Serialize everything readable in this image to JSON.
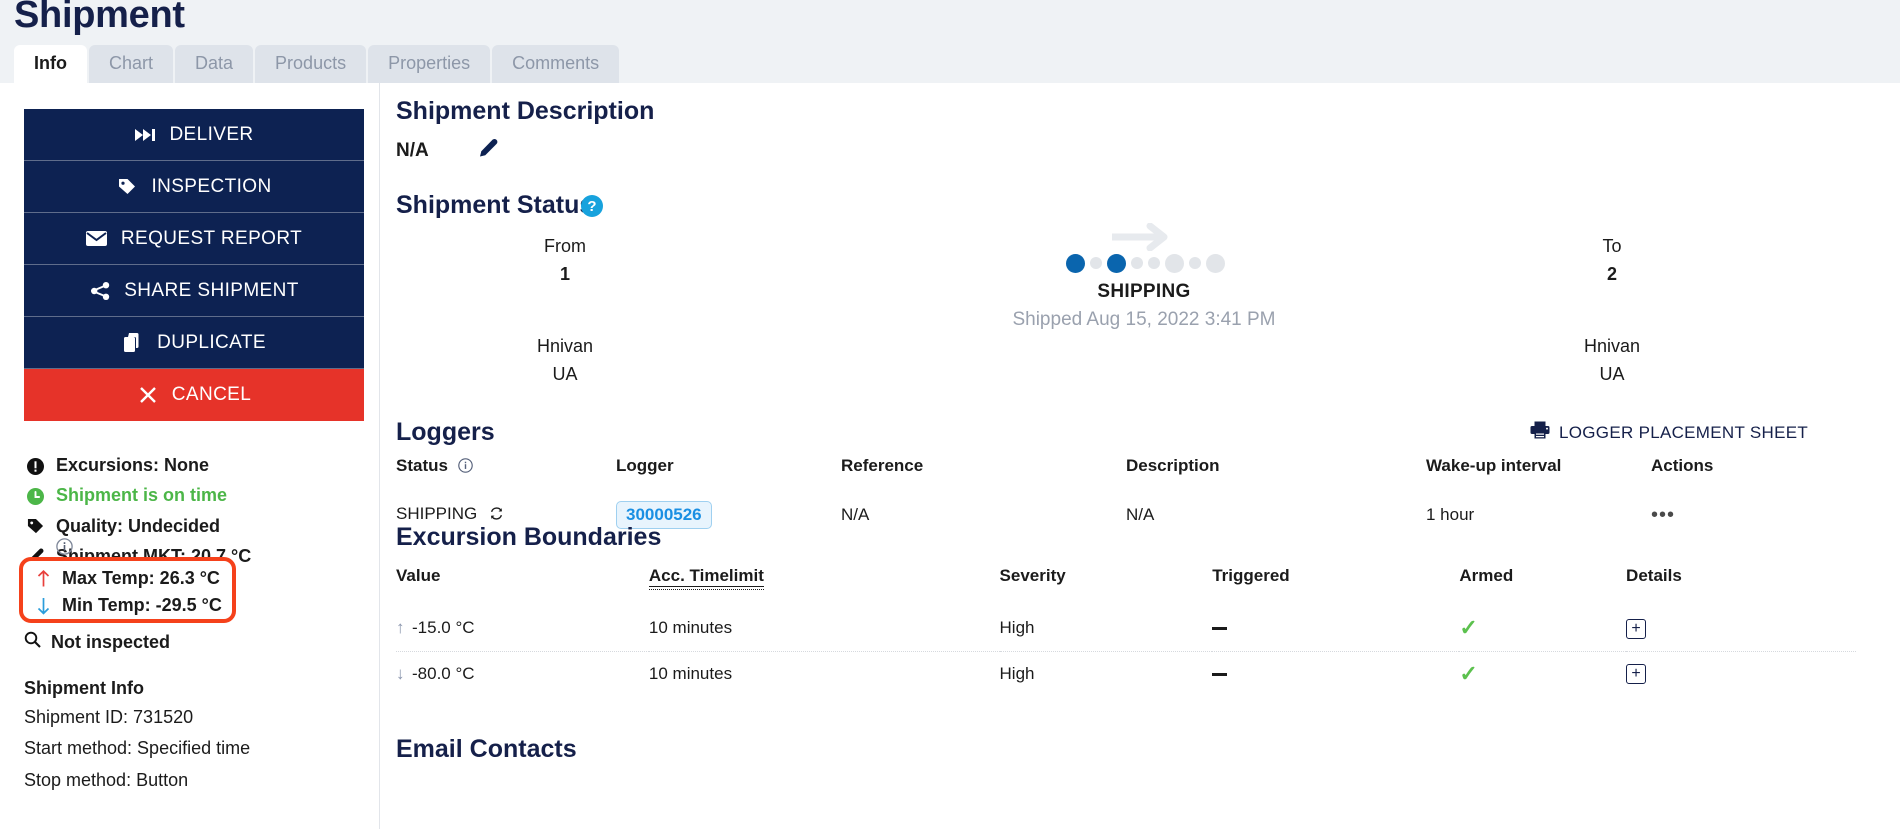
{
  "header": {
    "title": "Shipment",
    "tabs": [
      {
        "label": "Info",
        "active": true
      },
      {
        "label": "Chart",
        "active": false
      },
      {
        "label": "Data",
        "active": false
      },
      {
        "label": "Products",
        "active": false
      },
      {
        "label": "Properties",
        "active": false
      },
      {
        "label": "Comments",
        "active": false
      }
    ]
  },
  "sidebar": {
    "actions": [
      {
        "label": "DELIVER",
        "icon": "fast-forward-icon",
        "style": "dark"
      },
      {
        "label": "INSPECTION",
        "icon": "tag-icon",
        "style": "dark"
      },
      {
        "label": "REQUEST REPORT",
        "icon": "envelope-icon",
        "style": "dark"
      },
      {
        "label": "SHARE SHIPMENT",
        "icon": "share-icon",
        "style": "dark"
      },
      {
        "label": "DUPLICATE",
        "icon": "copy-icon",
        "style": "dark"
      },
      {
        "label": "CANCEL",
        "icon": "close-icon",
        "style": "danger"
      }
    ],
    "status": {
      "excursions": "Excursions: None",
      "on_time": "Shipment is on time",
      "quality": "Quality: Undecided",
      "mkt": "Shipment MKT: 20.7 °C",
      "max_temp": "Max Temp: 26.3 °C",
      "min_temp": "Min Temp: -29.5 °C",
      "inspected": "Not inspected"
    },
    "shipment_info": {
      "title": "Shipment Info",
      "shipment_id": "Shipment ID: 731520",
      "start_method": "Start method: Specified time",
      "stop_method": "Stop method: Button"
    }
  },
  "main": {
    "description": {
      "title": "Shipment Description",
      "value": "N/A"
    },
    "status_section": {
      "title": "Shipment Status",
      "help": "?",
      "from": {
        "head": "From",
        "num": "1",
        "city": "Hnivan",
        "country": "UA"
      },
      "to": {
        "head": "To",
        "num": "2",
        "city": "Hnivan",
        "country": "UA"
      },
      "progress": {
        "label": "SHIPPING",
        "sub": "Shipped Aug 15, 2022 3:41 PM",
        "dots": [
          {
            "size": "big",
            "color": "blue"
          },
          {
            "size": "small",
            "color": "grey"
          },
          {
            "size": "big",
            "color": "blue"
          },
          {
            "size": "small",
            "color": "grey"
          },
          {
            "size": "small",
            "color": "grey"
          },
          {
            "size": "big",
            "color": "grey"
          },
          {
            "size": "small",
            "color": "grey"
          },
          {
            "size": "big",
            "color": "grey"
          }
        ]
      }
    },
    "loggers": {
      "title": "Loggers",
      "placement_sheet_label": "LOGGER PLACEMENT SHEET",
      "columns": [
        "Status",
        "Logger",
        "Reference",
        "Description",
        "Wake-up interval",
        "Actions"
      ],
      "rows": [
        {
          "status": "SHIPPING",
          "logger": "30000526",
          "reference": "N/A",
          "description": "N/A",
          "wakeup": "1 hour",
          "actions": "•••"
        }
      ]
    },
    "excursions": {
      "title": "Excursion Boundaries",
      "columns": [
        "Value",
        "Acc. Timelimit",
        "Severity",
        "Triggered",
        "Armed",
        "Details"
      ],
      "rows": [
        {
          "arrow": "up",
          "value": "-15.0 °C",
          "timelimit": "10 minutes",
          "severity": "High",
          "triggered": "—",
          "armed": "✓",
          "details": "+"
        },
        {
          "arrow": "down",
          "value": "-80.0 °C",
          "timelimit": "10 minutes",
          "severity": "High",
          "triggered": "—",
          "armed": "✓",
          "details": "+"
        }
      ]
    },
    "email_contacts": {
      "title": "Email Contacts"
    }
  },
  "colors": {
    "brand_dark": "#0d2252",
    "danger": "#e63329",
    "accent_blue": "#0a65ae",
    "green": "#4cb648",
    "highlight": "#f5411b"
  }
}
